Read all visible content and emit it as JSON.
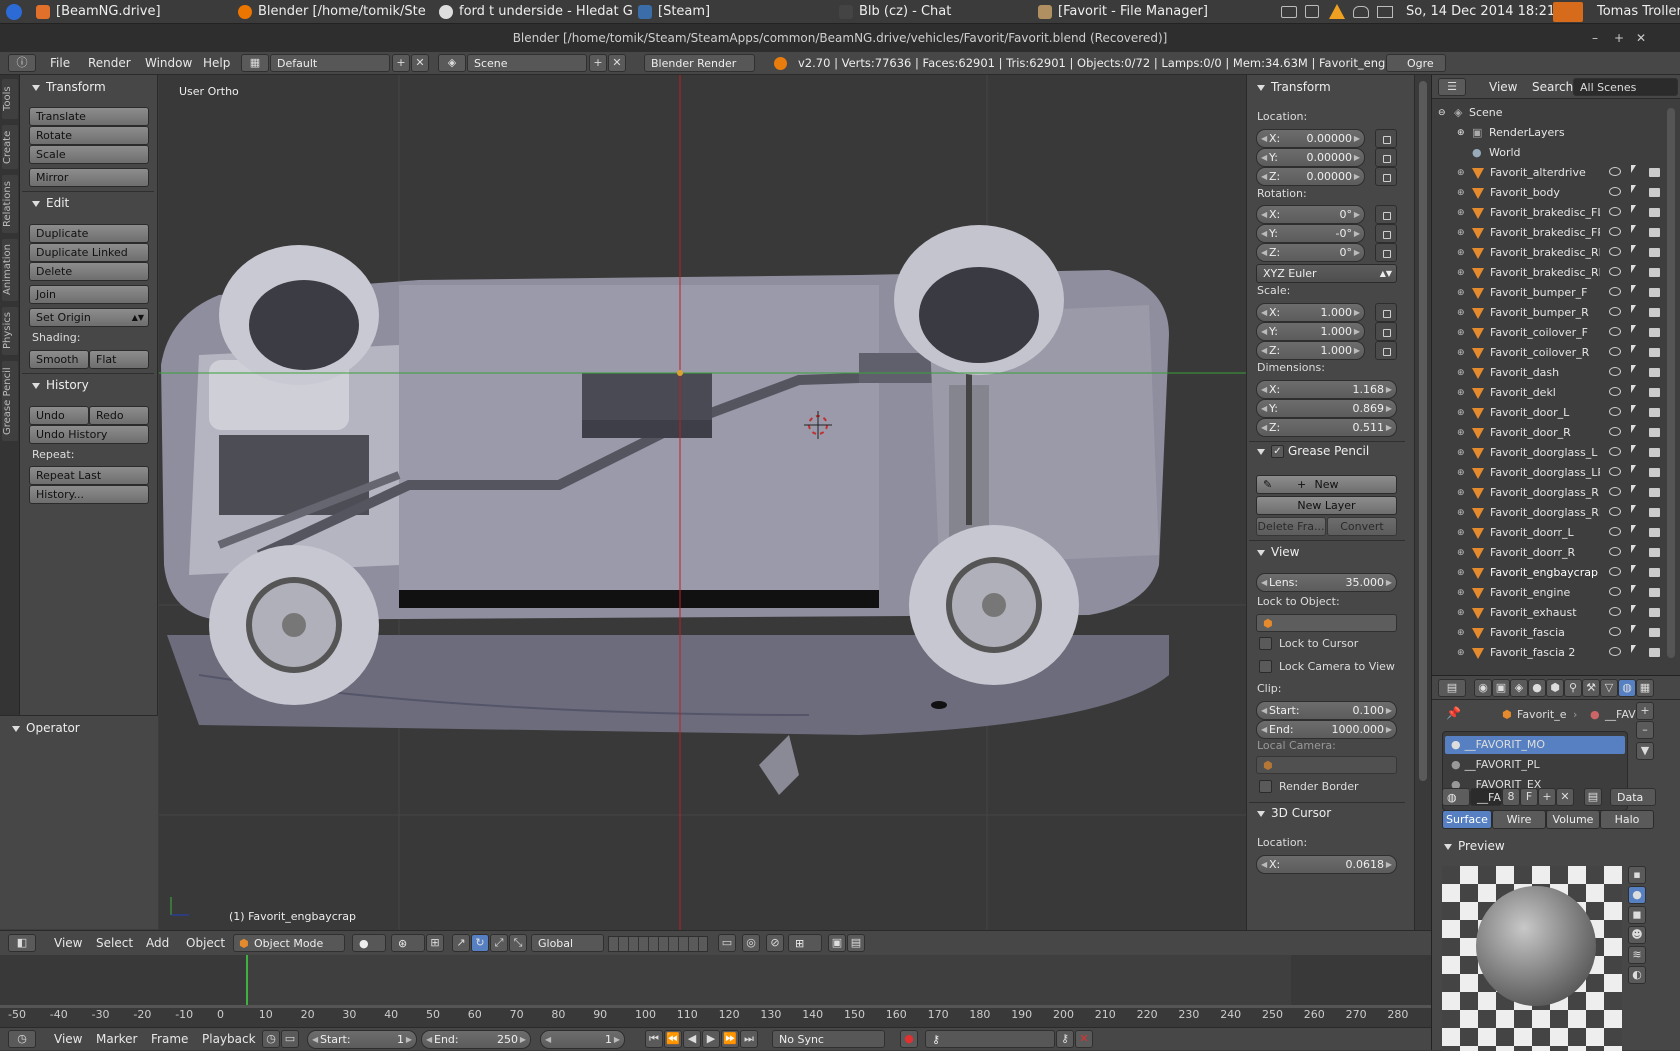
{
  "taskbar": {
    "tasks": [
      "[BeamNG.drive]",
      "Blender [/home/tomik/Ste...",
      "ford t underside - Hledat G...",
      "[Steam]",
      "Blb (cz) - Chat",
      "[Favorit - File Manager]"
    ],
    "clock": "So, 14 Dec 2014 18:21",
    "user": "Tomas Troller"
  },
  "window": {
    "title": "Blender [/home/tomik/Steam/SteamApps/common/BeamNG.drive/vehicles/Favorit/Favorit.blend (Recovered)]"
  },
  "menubar": {
    "menus": [
      "File",
      "Render",
      "Window",
      "Help"
    ],
    "layout": "Default",
    "scene": "Scene",
    "engine": "Blender Render",
    "stats": "v2.70 | Verts:77636 | Faces:62901 | Tris:62901 | Objects:0/72 | Lamps:0/0 | Mem:34.63M | Favorit_engbaycrap",
    "ogre": "Ogre"
  },
  "tabs": [
    "Tools",
    "Create",
    "Relations",
    "Animation",
    "Physics",
    "Grease Pencil"
  ],
  "tools": {
    "transform_title": "Transform",
    "translate": "Translate",
    "rotate": "Rotate",
    "scale": "Scale",
    "mirror": "Mirror",
    "edit_title": "Edit",
    "duplicate": "Duplicate",
    "duplicate_linked": "Duplicate Linked",
    "delete": "Delete",
    "join": "Join",
    "set_origin": "Set Origin",
    "shading_label": "Shading:",
    "smooth": "Smooth",
    "flat": "Flat",
    "history_title": "History",
    "undo": "Undo",
    "redo": "Redo",
    "undo_history": "Undo History",
    "repeat_label": "Repeat:",
    "repeat_last": "Repeat Last",
    "history": "History...",
    "operator_title": "Operator"
  },
  "viewport": {
    "view_label": "User Ortho",
    "object_label": "(1) Favorit_engbaycrap"
  },
  "npanel": {
    "transform_title": "Transform",
    "location_label": "Location:",
    "loc": [
      {
        "k": "X:",
        "v": "0.00000"
      },
      {
        "k": "Y:",
        "v": "0.00000"
      },
      {
        "k": "Z:",
        "v": "0.00000"
      }
    ],
    "rotation_label": "Rotation:",
    "rot": [
      {
        "k": "X:",
        "v": "0°"
      },
      {
        "k": "Y:",
        "v": "-0°"
      },
      {
        "k": "Z:",
        "v": "0°"
      }
    ],
    "rotation_mode": "XYZ Euler",
    "scale_label": "Scale:",
    "scl": [
      {
        "k": "X:",
        "v": "1.000"
      },
      {
        "k": "Y:",
        "v": "1.000"
      },
      {
        "k": "Z:",
        "v": "1.000"
      }
    ],
    "dimensions_label": "Dimensions:",
    "dim": [
      {
        "k": "X:",
        "v": "1.168"
      },
      {
        "k": "Y:",
        "v": "0.869"
      },
      {
        "k": "Z:",
        "v": "0.511"
      }
    ],
    "grease_title": "Grease Pencil",
    "gp_new": "New",
    "gp_new_layer": "New Layer",
    "gp_delete_frame": "Delete Fra...",
    "gp_convert": "Convert",
    "view_title": "View",
    "lens_k": "Lens:",
    "lens_v": "35.000",
    "lock_object_label": "Lock to Object:",
    "lock_cursor": "Lock to Cursor",
    "lock_camera": "Lock Camera to View",
    "clip_label": "Clip:",
    "clip_start_k": "Start:",
    "clip_start_v": "0.100",
    "clip_end_k": "End:",
    "clip_end_v": "1000.000",
    "local_camera_label": "Local Camera:",
    "render_border": "Render Border",
    "cursor_title": "3D Cursor",
    "cursor_location_label": "Location:",
    "cursor_x_k": "X:",
    "cursor_x_v": "0.0618"
  },
  "outliner": {
    "menus": [
      "View",
      "Search"
    ],
    "filter": "All Scenes",
    "scene": "Scene",
    "renderlayers": "RenderLayers",
    "world": "World",
    "objects": [
      "Favorit_alterdrive",
      "Favorit_body",
      "Favorit_brakedisc_FL",
      "Favorit_brakedisc_FR",
      "Favorit_brakedisc_RL",
      "Favorit_brakedisc_RR",
      "Favorit_bumper_F",
      "Favorit_bumper_R",
      "Favorit_coilover_F",
      "Favorit_coilover_R",
      "Favorit_dash",
      "Favorit_dekl",
      "Favorit_door_L",
      "Favorit_door_R",
      "Favorit_doorglass_L",
      "Favorit_doorglass_LR",
      "Favorit_doorglass_R",
      "Favorit_doorglass_RR",
      "Favorit_doorr_L",
      "Favorit_doorr_R",
      "Favorit_engbaycrap",
      "Favorit_engine",
      "Favorit_exhaust",
      "Favorit_fascia",
      "Favorit_fascia 2"
    ],
    "selected": "Favorit_engbaycrap"
  },
  "properties": {
    "breadcrumb_object": "Favorit_e",
    "breadcrumb_material": "__FAVO",
    "slots": [
      "__FAVORIT_MO",
      "__FAVORIT_PL",
      "__FAVORIT_EX"
    ],
    "material_name": "__FA",
    "users": "8",
    "fake": "F",
    "link": "Data",
    "tabs": [
      "Surface",
      "Wire",
      "Volume",
      "Halo"
    ],
    "preview_title": "Preview"
  },
  "vpheader": {
    "menus": [
      "View",
      "Select",
      "Add",
      "Object"
    ],
    "mode": "Object Mode",
    "orientation": "Global"
  },
  "timeline": {
    "ticks": [
      "-50",
      "-40",
      "-30",
      "-20",
      "-10",
      "0",
      "10",
      "20",
      "30",
      "40",
      "50",
      "60",
      "70",
      "80",
      "90",
      "100",
      "110",
      "120",
      "130",
      "140",
      "150",
      "160",
      "170",
      "180",
      "190",
      "200",
      "210",
      "220",
      "230",
      "240",
      "250",
      "260",
      "270",
      "280"
    ],
    "menus": [
      "View",
      "Marker",
      "Frame",
      "Playback"
    ],
    "start_k": "Start:",
    "start_v": "1",
    "end_k": "End:",
    "end_v": "250",
    "current": "1",
    "sync": "No Sync"
  }
}
